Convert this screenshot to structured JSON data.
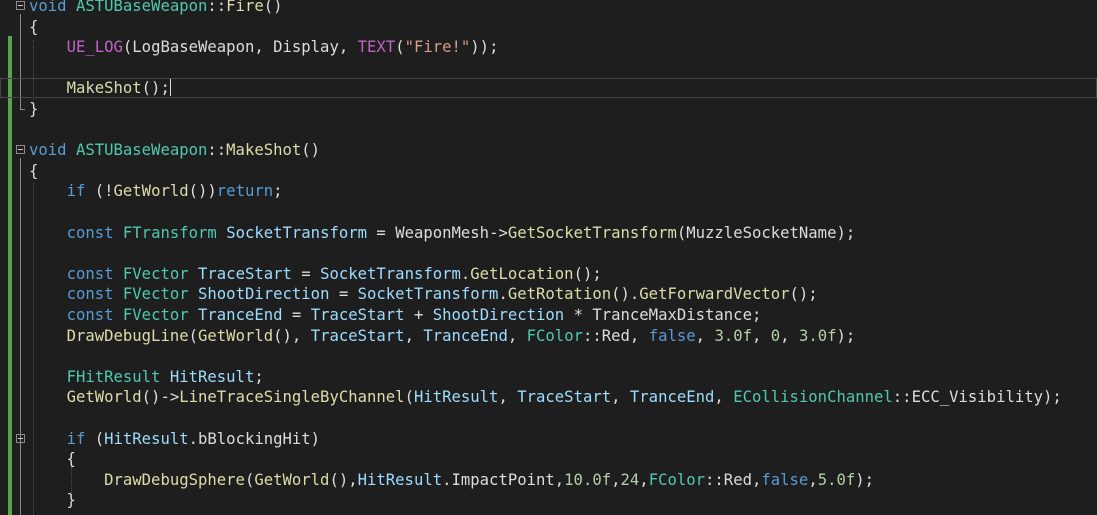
{
  "editor": {
    "lines": [
      {
        "segments": [
          [
            "keyword",
            "void"
          ],
          [
            "plain",
            " "
          ],
          [
            "type",
            "ASTUBaseWeapon"
          ],
          [
            "plain",
            "::"
          ],
          [
            "func",
            "Fire"
          ],
          [
            "plain",
            "()"
          ]
        ]
      },
      {
        "segments": [
          [
            "plain",
            "{"
          ]
        ]
      },
      {
        "segments": [
          [
            "plain",
            "    "
          ],
          [
            "macro",
            "UE_LOG"
          ],
          [
            "plain",
            "(LogBaseWeapon, Display, "
          ],
          [
            "macro",
            "TEXT"
          ],
          [
            "plain",
            "("
          ],
          [
            "str",
            "\"Fire!\""
          ],
          [
            "plain",
            "));"
          ]
        ]
      },
      {
        "segments": []
      },
      {
        "segments": [
          [
            "plain",
            "    "
          ],
          [
            "func",
            "MakeShot"
          ],
          [
            "plain",
            "();"
          ]
        ],
        "caret": true
      },
      {
        "segments": [
          [
            "plain",
            "}"
          ]
        ]
      },
      {
        "segments": []
      },
      {
        "segments": [
          [
            "keyword",
            "void"
          ],
          [
            "plain",
            " "
          ],
          [
            "type",
            "ASTUBaseWeapon"
          ],
          [
            "plain",
            "::"
          ],
          [
            "func",
            "MakeShot"
          ],
          [
            "plain",
            "()"
          ]
        ]
      },
      {
        "segments": [
          [
            "plain",
            "{"
          ]
        ]
      },
      {
        "segments": [
          [
            "plain",
            "    "
          ],
          [
            "keyword",
            "if"
          ],
          [
            "plain",
            " (!"
          ],
          [
            "func",
            "GetWorld"
          ],
          [
            "plain",
            "())"
          ],
          [
            "keyword",
            "return"
          ],
          [
            "plain",
            ";"
          ]
        ]
      },
      {
        "segments": []
      },
      {
        "segments": [
          [
            "plain",
            "    "
          ],
          [
            "keyword",
            "const"
          ],
          [
            "plain",
            " "
          ],
          [
            "type",
            "FTransform"
          ],
          [
            "plain",
            " "
          ],
          [
            "var",
            "SocketTransform"
          ],
          [
            "plain",
            " = "
          ],
          [
            "plain",
            "WeaponMesh->"
          ],
          [
            "func",
            "GetSocketTransform"
          ],
          [
            "plain",
            "(MuzzleSocketName);"
          ]
        ]
      },
      {
        "segments": []
      },
      {
        "segments": [
          [
            "plain",
            "    "
          ],
          [
            "keyword",
            "const"
          ],
          [
            "plain",
            " "
          ],
          [
            "type",
            "FVector"
          ],
          [
            "plain",
            " "
          ],
          [
            "var",
            "TraceStart"
          ],
          [
            "plain",
            " = "
          ],
          [
            "var",
            "SocketTransform"
          ],
          [
            "plain",
            "."
          ],
          [
            "func",
            "GetLocation"
          ],
          [
            "plain",
            "();"
          ]
        ]
      },
      {
        "segments": [
          [
            "plain",
            "    "
          ],
          [
            "keyword",
            "const"
          ],
          [
            "plain",
            " "
          ],
          [
            "type",
            "FVector"
          ],
          [
            "plain",
            " "
          ],
          [
            "var",
            "ShootDirection"
          ],
          [
            "plain",
            " = "
          ],
          [
            "var",
            "SocketTransform"
          ],
          [
            "plain",
            "."
          ],
          [
            "func",
            "GetRotation"
          ],
          [
            "plain",
            "()."
          ],
          [
            "func",
            "GetForwardVector"
          ],
          [
            "plain",
            "();"
          ]
        ]
      },
      {
        "segments": [
          [
            "plain",
            "    "
          ],
          [
            "keyword",
            "const"
          ],
          [
            "plain",
            " "
          ],
          [
            "type",
            "FVector"
          ],
          [
            "plain",
            " "
          ],
          [
            "var",
            "TranceEnd"
          ],
          [
            "plain",
            " = "
          ],
          [
            "var",
            "TraceStart"
          ],
          [
            "plain",
            " + "
          ],
          [
            "var",
            "ShootDirection"
          ],
          [
            "plain",
            " * TranceMaxDistance;"
          ]
        ]
      },
      {
        "segments": [
          [
            "plain",
            "    "
          ],
          [
            "func",
            "DrawDebugLine"
          ],
          [
            "plain",
            "("
          ],
          [
            "func",
            "GetWorld"
          ],
          [
            "plain",
            "(), "
          ],
          [
            "var",
            "TraceStart"
          ],
          [
            "plain",
            ", "
          ],
          [
            "var",
            "TranceEnd"
          ],
          [
            "plain",
            ", "
          ],
          [
            "type",
            "FColor"
          ],
          [
            "plain",
            "::Red, "
          ],
          [
            "keyword",
            "false"
          ],
          [
            "plain",
            ", "
          ],
          [
            "num",
            "3.0f"
          ],
          [
            "plain",
            ", "
          ],
          [
            "num",
            "0"
          ],
          [
            "plain",
            ", "
          ],
          [
            "num",
            "3.0f"
          ],
          [
            "plain",
            ");"
          ]
        ]
      },
      {
        "segments": []
      },
      {
        "segments": [
          [
            "plain",
            "    "
          ],
          [
            "type",
            "FHitResult"
          ],
          [
            "plain",
            " "
          ],
          [
            "var",
            "HitResult"
          ],
          [
            "plain",
            ";"
          ]
        ]
      },
      {
        "segments": [
          [
            "plain",
            "    "
          ],
          [
            "func",
            "GetWorld"
          ],
          [
            "plain",
            "()->"
          ],
          [
            "func",
            "LineTraceSingleByChannel"
          ],
          [
            "plain",
            "("
          ],
          [
            "var",
            "HitResult"
          ],
          [
            "plain",
            ", "
          ],
          [
            "var",
            "TraceStart"
          ],
          [
            "plain",
            ", "
          ],
          [
            "var",
            "TranceEnd"
          ],
          [
            "plain",
            ", "
          ],
          [
            "type",
            "ECollisionChannel"
          ],
          [
            "plain",
            "::ECC_Visibility);"
          ]
        ]
      },
      {
        "segments": []
      },
      {
        "segments": [
          [
            "plain",
            "    "
          ],
          [
            "keyword",
            "if"
          ],
          [
            "plain",
            " ("
          ],
          [
            "var",
            "HitResult"
          ],
          [
            "plain",
            ".bBlockingHit)"
          ]
        ]
      },
      {
        "segments": [
          [
            "plain",
            "    {"
          ]
        ]
      },
      {
        "segments": [
          [
            "plain",
            "        "
          ],
          [
            "func",
            "DrawDebugSphere"
          ],
          [
            "plain",
            "("
          ],
          [
            "func",
            "GetWorld"
          ],
          [
            "plain",
            "(),"
          ],
          [
            "var",
            "HitResult"
          ],
          [
            "plain",
            ".ImpactPoint,"
          ],
          [
            "num",
            "10.0f"
          ],
          [
            "plain",
            ","
          ],
          [
            "num",
            "24"
          ],
          [
            "plain",
            ","
          ],
          [
            "type",
            "FColor"
          ],
          [
            "plain",
            "::Red,"
          ],
          [
            "keyword",
            "false"
          ],
          [
            "plain",
            ","
          ],
          [
            "num",
            "5.0f"
          ],
          [
            "plain",
            ");"
          ]
        ]
      },
      {
        "segments": [
          [
            "plain",
            "    }"
          ]
        ]
      },
      {
        "segments": []
      }
    ]
  },
  "colors": {
    "background": "#1e1e1e",
    "keyword": "#569cd6",
    "type": "#4ec9b0",
    "function": "#dcdcaa",
    "variable": "#9cdcfe",
    "number": "#b5cea8",
    "string": "#d69d85",
    "macro": "#bd63c5",
    "plain": "#dcdcdc",
    "change_bar": "#57a64a"
  }
}
